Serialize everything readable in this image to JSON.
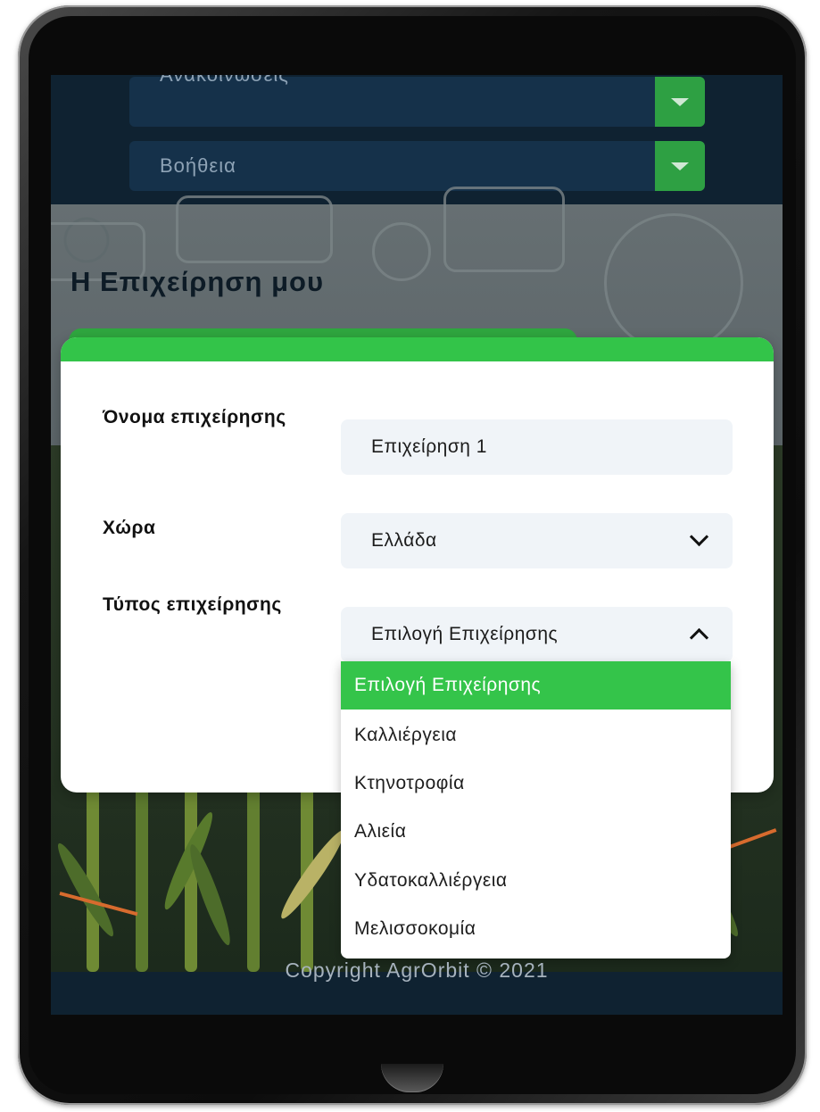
{
  "menu": {
    "items": [
      {
        "label": "Ανακοινώσεις"
      },
      {
        "label": "Βοήθεια"
      }
    ]
  },
  "page": {
    "title": "Η Επιχείρηση μου"
  },
  "form": {
    "business_name": {
      "label": "Όνομα επιχείρησης",
      "value": "Επιχείρηση 1"
    },
    "country": {
      "label": "Χώρα",
      "value": "Ελλάδα"
    },
    "business_type": {
      "label": "Τύπος επιχείρησης",
      "value": "Επιλογή Επιχείρησης"
    }
  },
  "dropdown": {
    "options": [
      "Επιλογή Επιχείρησης",
      "Καλλιέργεια",
      "Κτηνοτροφία",
      "Αλιεία",
      "Υδατοκαλλιέργεια",
      "Μελισσοκομία"
    ],
    "selected_index": 0
  },
  "footer": {
    "copyright": "Copyright AgrOrbit © 2021"
  },
  "colors": {
    "accent": "#33c449",
    "menu_bg": "#15314a",
    "footer_bg": "#0f2231"
  }
}
